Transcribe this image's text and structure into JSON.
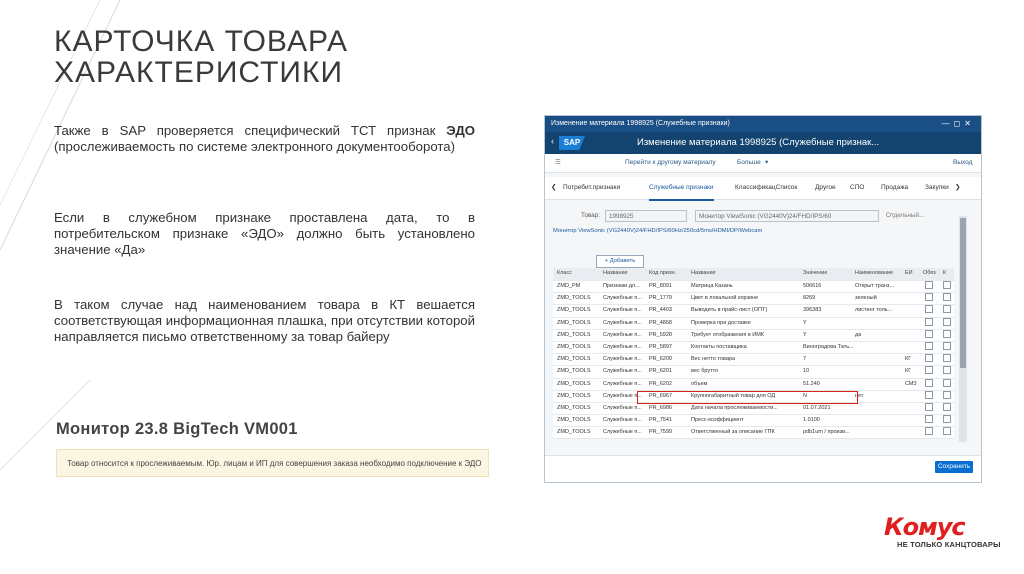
{
  "slide": {
    "title_line1": "КАРТОЧКА ТОВАРА",
    "title_line2": "ХАРАКТЕРИСТИКИ",
    "p1_pre": "Также в SAP проверяется специфический ТСТ признак ",
    "p1_bold": "ЭДО",
    "p1_post": " (прослеживаемость по системе электронного документооборота)",
    "p2": "Если в служебном признаке проставлена дата, то в потребительском признаке «ЭДО» должно быть установлено значение «Да»",
    "p3": "В таком случае над наименованием товара в КТ вешается соответствующая информационная плашка, при отсутствии которой направляется письмо ответственному за товар байеру",
    "monitor_title": "Монитор 23.8 BigTech VM001",
    "notice": "Товар относится к прослеживаемым. Юр. лицам и ИП для совершения заказа необходимо подключение к ЭДО"
  },
  "sap": {
    "window_title": "Изменение материала 1998925 (Служебные признаки)",
    "shell_title": "Изменение материала 1998925 (Служебные признак...",
    "logo": "SAP",
    "toolbar": {
      "goto": "Перейти к другому материалу",
      "more": "Больше",
      "exit": "Выход"
    },
    "tabs": [
      "Потребит.признаки",
      "Служебные признаки",
      "КлассификацСписок",
      "Другое",
      "СПО",
      "Продажа",
      "Закупки"
    ],
    "product_label": "Товар:",
    "product_number": "1998925",
    "product_name": "Монитор ViewSonic (VG2440V)24/FHD/IPS/60",
    "product_after": "Отдельный...",
    "full_name": "Монитор ViewSonic (VG2440V)24/FHD/IPS/60Hz/250cd/5ms/HDMI/DP/Webcam",
    "add_button": "Добавить",
    "headers": [
      "Класс",
      "Название",
      "Код призн.",
      "Название",
      "Значение",
      "Наименование",
      "ЕИ",
      "Обяз",
      "К"
    ],
    "rows": [
      {
        "cls": "ZMD_PM",
        "name": "Признаки дл...",
        "code": "PR_8091",
        "desc": "Матрица Казань",
        "val": "506616",
        "vname": "Открыт транз...",
        "unit": ""
      },
      {
        "cls": "ZMD_TOOLS",
        "name": "Служебные п...",
        "code": "PR_1779",
        "desc": "Цвет в локальной корзине",
        "val": "8269",
        "vname": "зеленый",
        "unit": ""
      },
      {
        "cls": "ZMD_TOOLS",
        "name": "Служебные п...",
        "code": "PR_4403",
        "desc": "Выводить в прайс-лист (ОПТ)",
        "val": "396383",
        "vname": "листинг толь...",
        "unit": ""
      },
      {
        "cls": "ZMD_TOOLS",
        "name": "Служебные п...",
        "code": "PR_4868",
        "desc": "Проверка при доставке",
        "val": "Y",
        "vname": "",
        "unit": ""
      },
      {
        "cls": "ZMD_TOOLS",
        "name": "Служебные п...",
        "code": "PR_5928",
        "desc": "Требует отображения в ИМК",
        "val": "Y",
        "vname": "да",
        "unit": ""
      },
      {
        "cls": "ZMD_TOOLS",
        "name": "Служебные п...",
        "code": "PR_5897",
        "desc": "Контакты поставщика",
        "val": "Виноградова Тать...",
        "vname": "",
        "unit": ""
      },
      {
        "cls": "ZMD_TOOLS",
        "name": "Служебные п...",
        "code": "PR_6200",
        "desc": "Вес нетто товара",
        "val": "7",
        "vname": "",
        "unit": "КГ"
      },
      {
        "cls": "ZMD_TOOLS",
        "name": "Служебные п...",
        "code": "PR_6201",
        "desc": "вес брутто",
        "val": "10",
        "vname": "",
        "unit": "КГ"
      },
      {
        "cls": "ZMD_TOOLS",
        "name": "Служебные п...",
        "code": "PR_6202",
        "desc": "объем",
        "val": "51.240",
        "vname": "",
        "unit": "СМ3"
      },
      {
        "cls": "ZMD_TOOLS",
        "name": "Служебные п...",
        "code": "PR_6967",
        "desc": "Крупногабаритный товар для ОД",
        "val": "N",
        "vname": "нет",
        "unit": ""
      },
      {
        "cls": "ZMD_TOOLS",
        "name": "Служебные п...",
        "code": "PR_6986",
        "desc": "Дата начала прослеживаемости...",
        "val": "01.07.2021",
        "vname": "",
        "unit": ""
      },
      {
        "cls": "ZMD_TOOLS",
        "name": "Служебные п...",
        "code": "PR_7541",
        "desc": "Пресс-коэффициент",
        "val": "1.0100",
        "vname": "",
        "unit": ""
      },
      {
        "cls": "ZMD_TOOLS",
        "name": "Служебные п...",
        "code": "PR_7599",
        "desc": "Ответственный за описание ГПК",
        "val": "pdb1um / произв...",
        "vname": "",
        "unit": ""
      }
    ],
    "save_button": "Сохранить"
  },
  "brand": {
    "logo_text": "Комус",
    "tagline": "НЕ ТОЛЬКО КАНЦТОВАРЫ",
    "accent": "#e02020"
  }
}
